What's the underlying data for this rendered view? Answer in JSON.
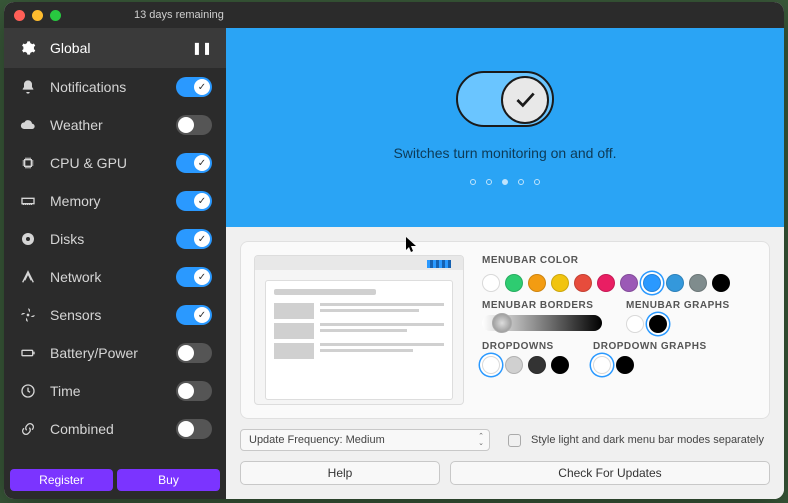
{
  "trial_text": "13 days remaining",
  "sidebar": {
    "items": [
      {
        "id": "global",
        "label": "Global",
        "on": true,
        "active": true
      },
      {
        "id": "notifications",
        "label": "Notifications",
        "on": true
      },
      {
        "id": "weather",
        "label": "Weather",
        "on": false
      },
      {
        "id": "cpu-gpu",
        "label": "CPU & GPU",
        "on": true
      },
      {
        "id": "memory",
        "label": "Memory",
        "on": true
      },
      {
        "id": "disks",
        "label": "Disks",
        "on": true
      },
      {
        "id": "network",
        "label": "Network",
        "on": true
      },
      {
        "id": "sensors",
        "label": "Sensors",
        "on": true
      },
      {
        "id": "battery-power",
        "label": "Battery/Power",
        "on": false
      },
      {
        "id": "time",
        "label": "Time",
        "on": false
      },
      {
        "id": "combined",
        "label": "Combined",
        "on": false
      }
    ],
    "register_label": "Register",
    "buy_label": "Buy"
  },
  "hero": {
    "caption": "Switches turn monitoring on and off.",
    "page_index": 2,
    "page_count": 5
  },
  "options": {
    "menubar_color": {
      "label": "MENUBAR COLOR",
      "swatches": [
        "#ffffff",
        "#2ecc71",
        "#f39c12",
        "#f1c40f",
        "#e74c3c",
        "#e91e63",
        "#9b59b6",
        "#2a99ff",
        "#3498db",
        "#7f8c8d",
        "#000000"
      ],
      "selected": 7
    },
    "menubar_borders": {
      "label": "MENUBAR BORDERS"
    },
    "menubar_graphs": {
      "label": "MENUBAR GRAPHS",
      "swatches": [
        "#ffffff",
        "#000000"
      ],
      "selected": 1
    },
    "dropdowns": {
      "label": "DROPDOWNS",
      "swatches": [
        "#ffffff",
        "#d0d0d0",
        "#333333",
        "#000000"
      ],
      "selected": 0
    },
    "dropdown_graphs": {
      "label": "DROPDOWN GRAPHS",
      "swatches": [
        "#ffffff",
        "#000000"
      ],
      "selected": 0
    },
    "update_frequency_label": "Update Frequency: Medium",
    "style_checkbox_label": "Style light and dark menu bar modes separately",
    "help_label": "Help",
    "check_updates_label": "Check For Updates"
  }
}
